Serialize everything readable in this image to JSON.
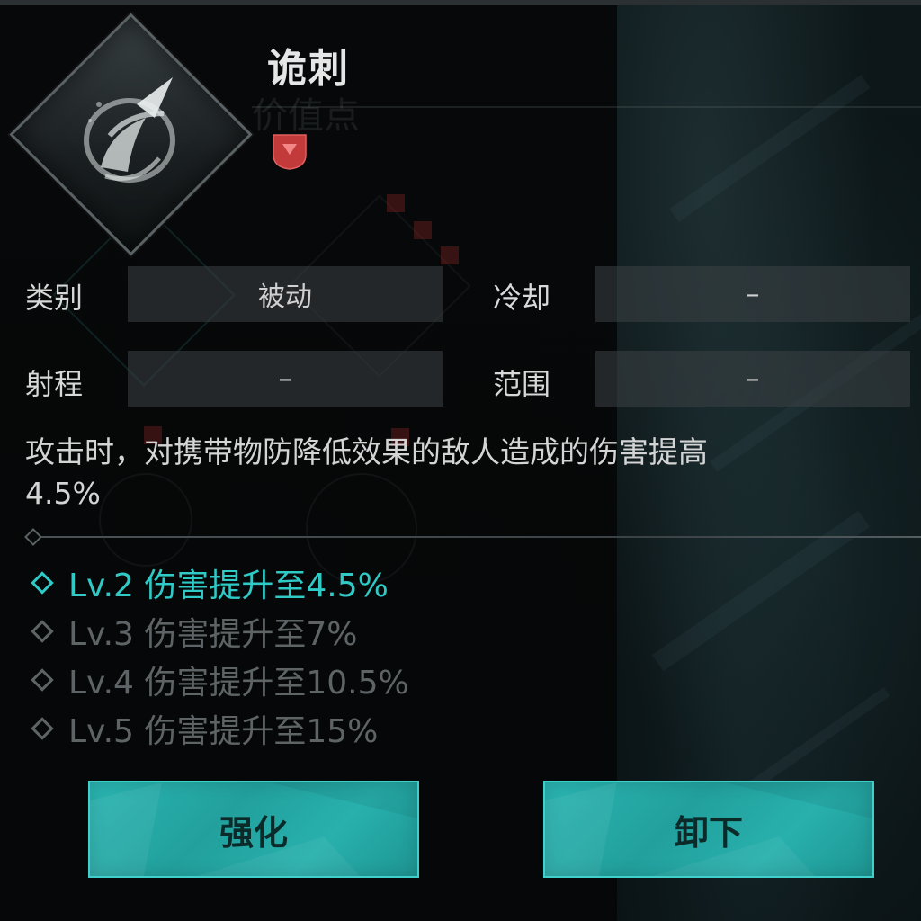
{
  "skill": {
    "name": "诡刺",
    "ghost_label": "价值点",
    "icon": "dagger-skill-icon",
    "badge_icon": "red-rank-badge"
  },
  "stats": {
    "category_label": "类别",
    "category_value": "被动",
    "cooldown_label": "冷却",
    "cooldown_value": "–",
    "range_label": "射程",
    "range_value": "–",
    "area_label": "范围",
    "area_value": "–"
  },
  "description": {
    "line1": "攻击时，对携带物防降低效果的敌人造成的伤害提高",
    "line2": "4.5%"
  },
  "levels": [
    {
      "text": "Lv.2 伤害提升至4.5%",
      "active": true
    },
    {
      "text": "Lv.3 伤害提升至7%",
      "active": false
    },
    {
      "text": "Lv.4 伤害提升至10.5%",
      "active": false
    },
    {
      "text": "Lv.5 伤害提升至15%",
      "active": false
    }
  ],
  "buttons": {
    "upgrade_label": "强化",
    "unequip_label": "卸下"
  },
  "colors": {
    "accent": "#2fc9c6",
    "button": "#22a09d",
    "inactive_level": "#5e6466",
    "badge": "#c23a3a"
  }
}
